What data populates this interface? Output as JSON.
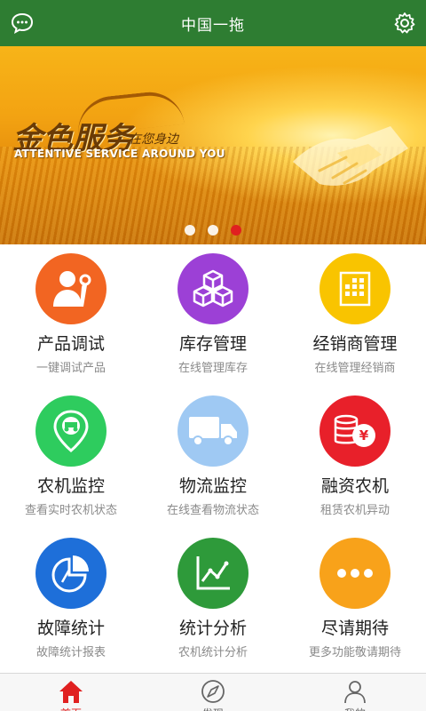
{
  "header": {
    "title": "中国一拖",
    "left_icon": "chat-bubble-icon",
    "right_icon": "gear-icon"
  },
  "banner": {
    "slogan": "金色服务",
    "slogan_small": "在您身边",
    "slogan_en": "ATTENTIVE SERVICE AROUND YOU",
    "carousel_total": 3,
    "carousel_active": 3
  },
  "features": [
    {
      "label": "产品调试",
      "desc": "一键调试产品",
      "icon": "technician-icon",
      "color": "#f26522"
    },
    {
      "label": "库存管理",
      "desc": "在线管理库存",
      "icon": "boxes-icon",
      "color": "#9c40d6"
    },
    {
      "label": "经销商管理",
      "desc": "在线管理经销商",
      "icon": "grid-doc-icon",
      "color": "#f9c400"
    },
    {
      "label": "农机监控",
      "desc": "查看实时农机状态",
      "icon": "location-tractor-icon",
      "color": "#2ecc5e"
    },
    {
      "label": "物流监控",
      "desc": "在线查看物流状态",
      "icon": "truck-icon",
      "color": "#9fc9f3"
    },
    {
      "label": "融资农机",
      "desc": "租赁农机异动",
      "icon": "coins-yen-icon",
      "color": "#e8202a"
    },
    {
      "label": "故障统计",
      "desc": "故障统计报表",
      "icon": "pie-chart-icon",
      "color": "#1e6fd9"
    },
    {
      "label": "统计分析",
      "desc": "农机统计分析",
      "icon": "line-chart-icon",
      "color": "#2e9a3a"
    },
    {
      "label": "尽请期待",
      "desc": "更多功能敬请期待",
      "icon": "more-dots-icon",
      "color": "#f8a21a"
    }
  ],
  "tabbar": {
    "items": [
      {
        "label": "首页",
        "icon": "home-icon",
        "active": true
      },
      {
        "label": "发现",
        "icon": "compass-icon",
        "active": false
      },
      {
        "label": "我的",
        "icon": "user-icon",
        "active": false
      }
    ],
    "active_color": "#e02020"
  }
}
